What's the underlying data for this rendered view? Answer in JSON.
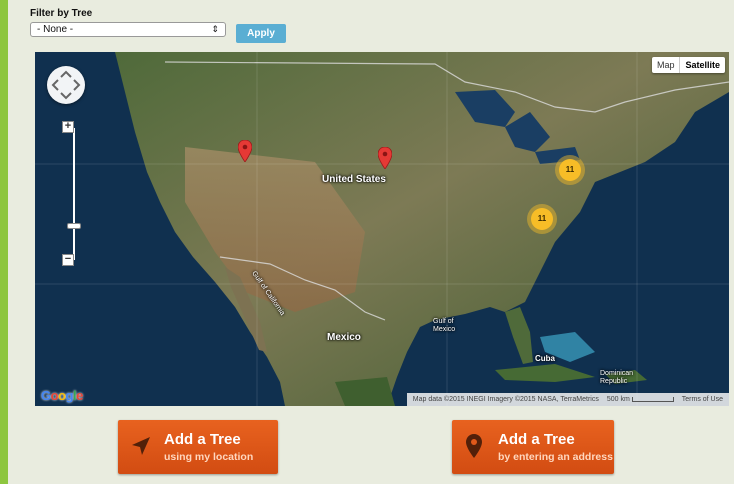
{
  "filter": {
    "label": "Filter by Tree",
    "selected": "- None -",
    "apply_label": "Apply"
  },
  "map": {
    "map_type_options": [
      "Map",
      "Satellite"
    ],
    "selected_map_type": "Satellite",
    "labels": {
      "country_usa": "United States",
      "country_mexico": "Mexico",
      "gulf": "Gulf of Mexico",
      "baja": "Gulf of California",
      "cuba": "Cuba",
      "dominican": "Dominican Republic"
    },
    "clusters": [
      {
        "count": "11"
      },
      {
        "count": "11"
      }
    ],
    "google_logo": "Google",
    "attribution": {
      "data": "Map data ©2015 INEGI Imagery ©2015 NASA, TerraMetrics",
      "scale": "500 km",
      "terms": "Terms of Use"
    }
  },
  "actions": {
    "location": {
      "title": "Add a Tree",
      "subtitle": "using my location"
    },
    "address": {
      "title": "Add a Tree",
      "subtitle": "by entering an address"
    }
  },
  "colors": {
    "page_border": "#8dc63f",
    "apply_button": "#5aaed3",
    "cta": "#e05a18",
    "pin": "#e53935",
    "cluster": "#f7bd27"
  }
}
